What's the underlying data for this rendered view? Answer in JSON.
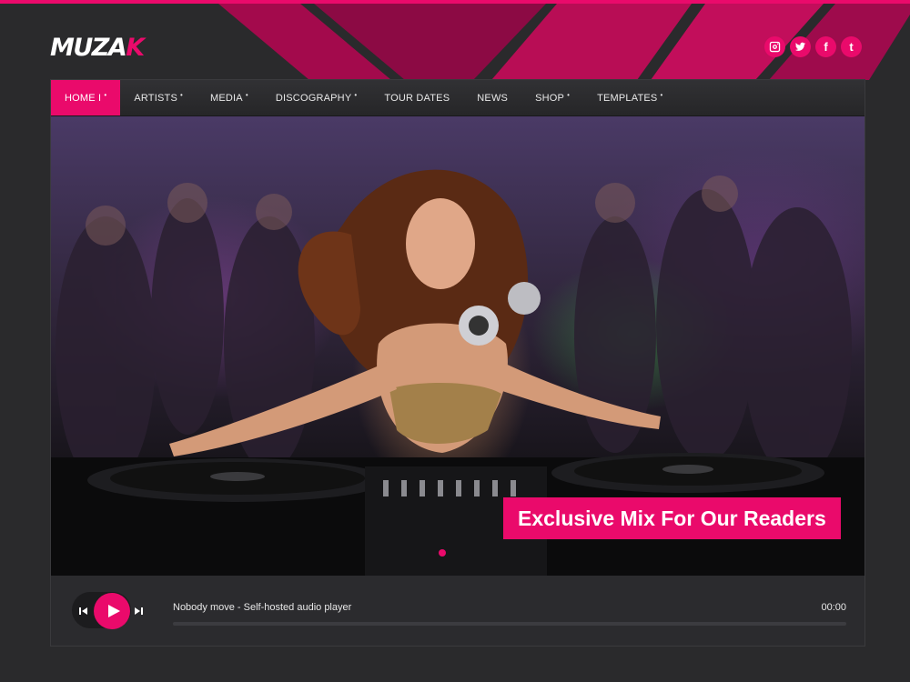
{
  "brand": {
    "logo_main": "MUZA",
    "logo_accent": "K"
  },
  "social": [
    {
      "name": "instagram-icon"
    },
    {
      "name": "twitter-icon"
    },
    {
      "name": "facebook-icon",
      "glyph": "f"
    },
    {
      "name": "tumblr-icon",
      "glyph": "t"
    }
  ],
  "nav": {
    "items": [
      {
        "label": "HOME I",
        "caret": "•",
        "active": true
      },
      {
        "label": "ARTISTS",
        "caret": "•"
      },
      {
        "label": "MEDIA",
        "caret": "•"
      },
      {
        "label": "DISCOGRAPHY",
        "caret": "•"
      },
      {
        "label": "TOUR DATES",
        "caret": ""
      },
      {
        "label": "NEWS",
        "caret": ""
      },
      {
        "label": "SHOP",
        "caret": "•"
      },
      {
        "label": "TEMPLATES",
        "caret": "•"
      }
    ]
  },
  "hero": {
    "caption": "Exclusive Mix For Our Readers"
  },
  "player": {
    "track_title": "Nobody move - Self-hosted audio player",
    "time": "00:00",
    "progress": 0
  },
  "colors": {
    "accent": "#ea0a6b",
    "background": "#2a2a2c"
  }
}
